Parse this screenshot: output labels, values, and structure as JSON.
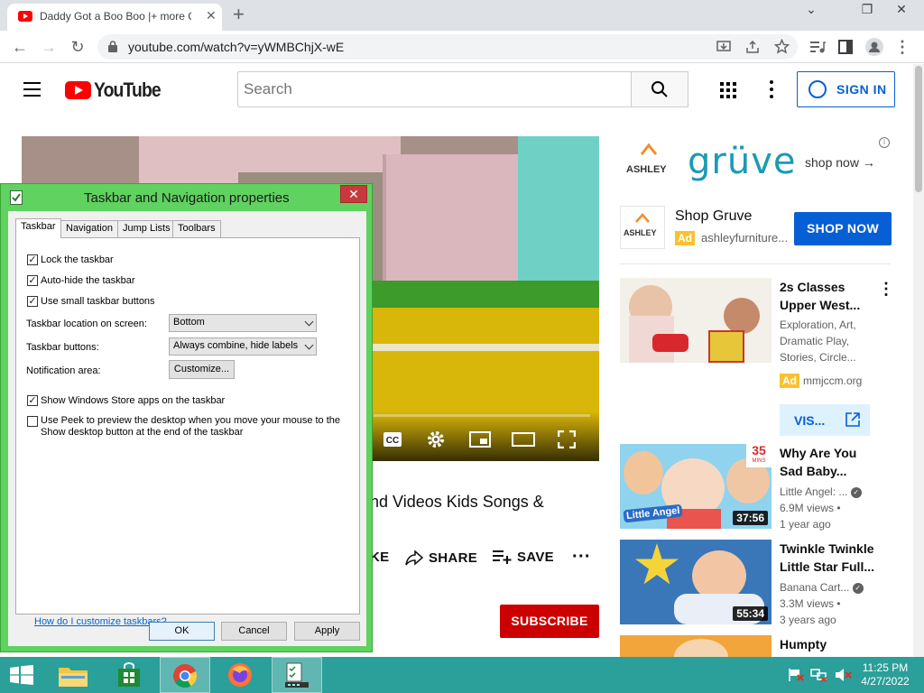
{
  "browser": {
    "tab_title": "Daddy Got a Boo Boo |+ more C",
    "tab_close": "✕",
    "new_tab": "+",
    "url": "youtube.com/watch?v=yWMBChjX-wE",
    "window_minimize": "⌄",
    "window_restore": "❐",
    "window_close": "✕"
  },
  "youtube": {
    "logo_text": "YouTube",
    "search_placeholder": "Search",
    "signin_label": "SIGN IN",
    "video_title_fragment": "nd Videos Kids Songs &",
    "actions": {
      "like_fragment": "KE",
      "share": "SHARE",
      "save": "SAVE"
    },
    "subscribe_label": "SUBSCRIBE",
    "ad_banner": {
      "brand_small": "ASHLEY",
      "brand_big": "grüve",
      "cta": "shop now →",
      "info": "i"
    },
    "shop_card": {
      "logo_text": "ASHLEY",
      "name": "Shop Gruve",
      "ad_badge": "Ad",
      "domain": "ashleyfurniture...",
      "button": "SHOP NOW"
    },
    "recommendations": [
      {
        "title_lines": [
          "2s Classes",
          "Upper West..."
        ],
        "meta_lines": [
          "Exploration, Art,",
          "Dramatic Play,",
          "Stories, Circle..."
        ],
        "ad_badge": "Ad",
        "ad_domain": "mmjccm.org",
        "visit_label": "VIS..."
      },
      {
        "title_lines": [
          "Why Are You",
          "Sad Baby..."
        ],
        "channel": "Little Angel: ...",
        "views": "6.9M views •",
        "age": "1 year ago",
        "duration": "37:56",
        "badge_top": "35",
        "badge_small": "MINS",
        "brand": "Little Angel"
      },
      {
        "title_lines": [
          "Twinkle Twinkle",
          "Little Star Full..."
        ],
        "channel": "Banana Cart...",
        "views": "3.3M views •",
        "age": "3 years ago",
        "duration": "55:34"
      },
      {
        "title_lines": [
          "Humpty"
        ]
      }
    ]
  },
  "dialog": {
    "title": "Taskbar and Navigation properties",
    "close": "✕",
    "tabs": [
      "Taskbar",
      "Navigation",
      "Jump Lists",
      "Toolbars"
    ],
    "options": {
      "lock": {
        "label": "Lock the taskbar",
        "checked": true
      },
      "autohide": {
        "label": "Auto-hide the taskbar",
        "checked": true
      },
      "small": {
        "label": "Use small taskbar buttons",
        "checked": true
      },
      "store_apps": {
        "label": "Show Windows Store apps on the taskbar",
        "checked": true
      },
      "peek_line1": "Use Peek to preview the desktop when you move your mouse to the",
      "peek_line2": "Show desktop button at the end of the taskbar",
      "peek_checked": false
    },
    "location_label": "Taskbar location on screen:",
    "location_value": "Bottom",
    "buttons_label": "Taskbar buttons:",
    "buttons_value": "Always combine, hide labels",
    "notification_label": "Notification area:",
    "customize": "Customize...",
    "help_link": "How do I customize taskbars?",
    "ok": "OK",
    "cancel": "Cancel",
    "apply": "Apply",
    "check_glyph": "✓"
  },
  "taskbar": {
    "time": "11:25 PM",
    "date": "4/27/2022",
    "apps": [
      "start-button",
      "file-explorer",
      "store",
      "chrome",
      "firefox",
      "taskbar-properties"
    ]
  },
  "colors": {
    "youtube_red": "#ff0000",
    "youtube_blue": "#065fd4",
    "dialog_frame": "#5fd25f",
    "taskbar": "#2b9f99"
  }
}
